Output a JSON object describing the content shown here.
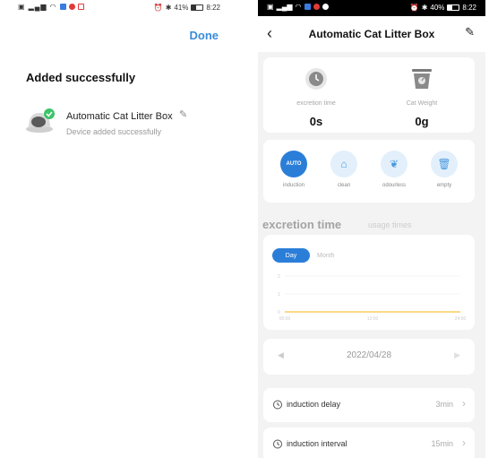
{
  "left": {
    "status_bar": {
      "battery": "41%",
      "time": "8:22"
    },
    "done_label": "Done",
    "title": "Added successfully",
    "device": {
      "name": "Automatic Cat Litter Box",
      "subtitle": "Device added successfully",
      "icons": [
        "litter-box-device-icon",
        "checkmark-badge-icon",
        "edit-pencil-icon"
      ]
    }
  },
  "right": {
    "status_bar": {
      "battery": "40%",
      "time": "8:22"
    },
    "nav": {
      "title": "Automatic Cat Litter Box",
      "icons": [
        "back-chevron-icon",
        "edit-pencil-icon"
      ]
    },
    "stats": [
      {
        "label": "excretion time",
        "value": "0s",
        "icon": "clock-icon"
      },
      {
        "label": "Cat Weight",
        "value": "0g",
        "icon": "scale-icon"
      }
    ],
    "modes": [
      {
        "label": "induction",
        "badge": "AUTO",
        "active": true
      },
      {
        "label": "clean",
        "icon": "broom-icon",
        "active": false
      },
      {
        "label": "odourless",
        "icon": "leaf-icon",
        "active": false
      },
      {
        "label": "empty",
        "icon": "trash-icon",
        "active": false
      }
    ],
    "section": {
      "active_tab": "excretion time",
      "inactive_tab": "usage times"
    },
    "period_toggle": {
      "selected": "Day",
      "other": "Month"
    },
    "chart_data": {
      "type": "line",
      "title": "",
      "xlabel": "",
      "ylabel": "",
      "x": [
        "00:00",
        "12:00",
        "24:00"
      ],
      "y_ticks": [
        "2",
        "1",
        "0"
      ],
      "ylim": [
        0,
        2
      ],
      "series": [
        {
          "values": [
            0,
            0,
            0
          ]
        }
      ],
      "line_color": "#f5c33b",
      "grid": true
    },
    "date": "2022/04/28",
    "settings": [
      {
        "label": "induction delay",
        "value": "3min"
      },
      {
        "label": "induction interval",
        "value": "15min"
      }
    ],
    "colors": {
      "accent": "#2b7ed8",
      "link": "#3b8bd9",
      "chart_line": "#f5c33b"
    }
  }
}
